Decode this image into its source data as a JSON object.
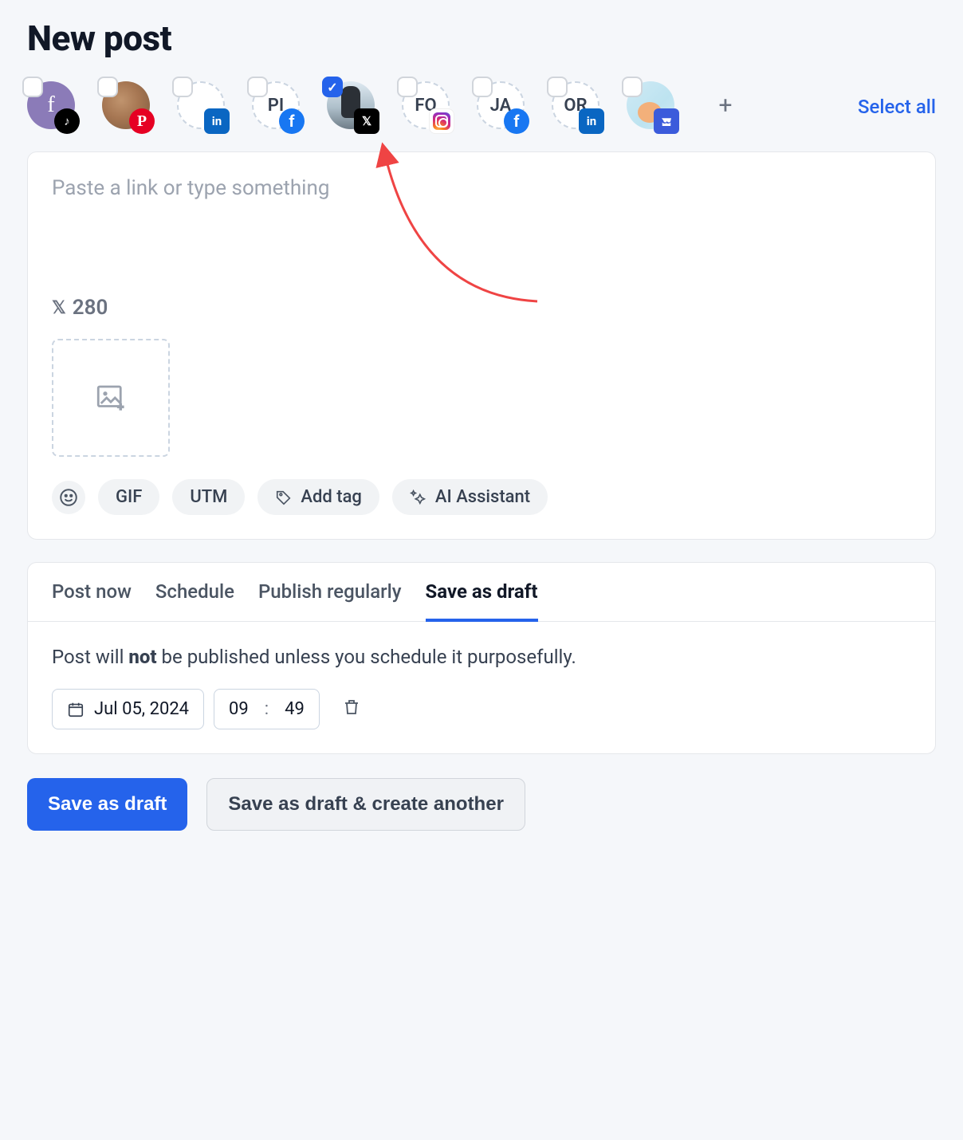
{
  "header": {
    "title": "New post"
  },
  "accounts": {
    "select_all_label": "Select all",
    "items": [
      {
        "initials": "f",
        "network": "tiktok",
        "checked": false,
        "avatar_style": "purple"
      },
      {
        "initials": "",
        "network": "pinterest",
        "checked": false,
        "avatar_style": "photo1"
      },
      {
        "initials": "",
        "network": "linkedin",
        "checked": false,
        "avatar_style": "dashed"
      },
      {
        "initials": "PI",
        "network": "facebook",
        "checked": false,
        "avatar_style": "dashed"
      },
      {
        "initials": "",
        "network": "x",
        "checked": true,
        "avatar_style": "photo2"
      },
      {
        "initials": "FO",
        "network": "instagram",
        "checked": false,
        "avatar_style": "dashed"
      },
      {
        "initials": "JA",
        "network": "facebook",
        "checked": false,
        "avatar_style": "dashed"
      },
      {
        "initials": "OR",
        "network": "linkedin",
        "checked": false,
        "avatar_style": "dashed"
      },
      {
        "initials": "",
        "network": "google",
        "checked": false,
        "avatar_style": "photo3"
      }
    ]
  },
  "compose": {
    "placeholder": "Paste a link or type something",
    "char_limit": "280",
    "chips": {
      "gif": "GIF",
      "utm": "UTM",
      "add_tag": "Add tag",
      "ai": "AI Assistant"
    }
  },
  "tabs": {
    "items": [
      {
        "label": "Post now",
        "active": false
      },
      {
        "label": "Schedule",
        "active": false
      },
      {
        "label": "Publish regularly",
        "active": false
      },
      {
        "label": "Save as draft",
        "active": true
      }
    ]
  },
  "draft": {
    "note_pre": "Post will ",
    "note_bold": "not",
    "note_post": " be published unless you schedule it purposefully.",
    "date": "Jul 05, 2024",
    "hour": "09",
    "minute": "49"
  },
  "actions": {
    "primary": "Save as draft",
    "secondary": "Save as draft & create another"
  }
}
